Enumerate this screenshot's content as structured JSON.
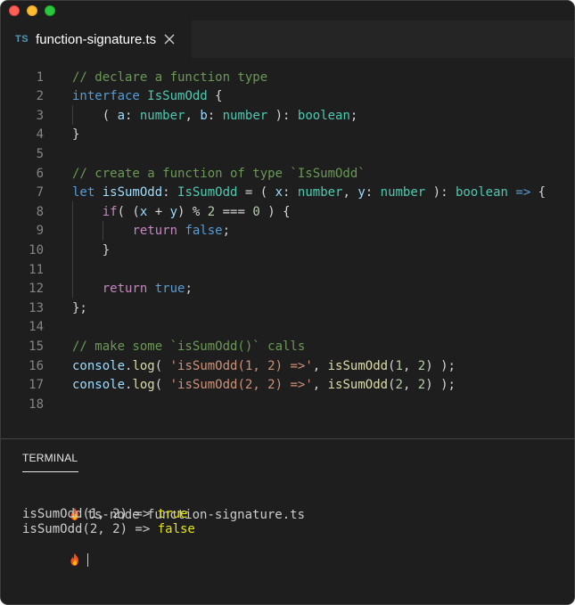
{
  "window": {
    "tab": {
      "lang_icon": "TS",
      "filename": "function-signature.ts",
      "close_icon": "close-icon"
    }
  },
  "editor": {
    "lines": [
      {
        "n": "1",
        "tokens": [
          {
            "t": "// declare a function type",
            "c": "c"
          }
        ]
      },
      {
        "n": "2",
        "tokens": [
          {
            "t": "interface ",
            "c": "k"
          },
          {
            "t": "IsSumOdd",
            "c": "t"
          },
          {
            "t": " {",
            "c": "p"
          }
        ]
      },
      {
        "n": "3",
        "tokens": [
          {
            "t": "    ( ",
            "c": "p"
          },
          {
            "t": "a",
            "c": "v"
          },
          {
            "t": ": ",
            "c": "p"
          },
          {
            "t": "number",
            "c": "t"
          },
          {
            "t": ", ",
            "c": "p"
          },
          {
            "t": "b",
            "c": "v"
          },
          {
            "t": ": ",
            "c": "p"
          },
          {
            "t": "number",
            "c": "t"
          },
          {
            "t": " ): ",
            "c": "p"
          },
          {
            "t": "boolean",
            "c": "t"
          },
          {
            "t": ";",
            "c": "p"
          }
        ]
      },
      {
        "n": "4",
        "tokens": [
          {
            "t": "}",
            "c": "p"
          }
        ]
      },
      {
        "n": "5",
        "tokens": []
      },
      {
        "n": "6",
        "tokens": [
          {
            "t": "// create a function of type `IsSumOdd`",
            "c": "c"
          }
        ]
      },
      {
        "n": "7",
        "tokens": [
          {
            "t": "let ",
            "c": "k"
          },
          {
            "t": "isSumOdd",
            "c": "v"
          },
          {
            "t": ": ",
            "c": "p"
          },
          {
            "t": "IsSumOdd",
            "c": "t"
          },
          {
            "t": " = ( ",
            "c": "p"
          },
          {
            "t": "x",
            "c": "v"
          },
          {
            "t": ": ",
            "c": "p"
          },
          {
            "t": "number",
            "c": "t"
          },
          {
            "t": ", ",
            "c": "p"
          },
          {
            "t": "y",
            "c": "v"
          },
          {
            "t": ": ",
            "c": "p"
          },
          {
            "t": "number",
            "c": "t"
          },
          {
            "t": " ): ",
            "c": "p"
          },
          {
            "t": "boolean",
            "c": "t"
          },
          {
            "t": " ",
            "c": "p"
          },
          {
            "t": "=>",
            "c": "k"
          },
          {
            "t": " {",
            "c": "p"
          }
        ]
      },
      {
        "n": "8",
        "tokens": [
          {
            "t": "    ",
            "c": "p"
          },
          {
            "t": "if",
            "c": "ck"
          },
          {
            "t": "( (",
            "c": "p"
          },
          {
            "t": "x",
            "c": "v"
          },
          {
            "t": " + ",
            "c": "p"
          },
          {
            "t": "y",
            "c": "v"
          },
          {
            "t": ") % ",
            "c": "p"
          },
          {
            "t": "2",
            "c": "n"
          },
          {
            "t": " === ",
            "c": "p"
          },
          {
            "t": "0",
            "c": "n"
          },
          {
            "t": " ) {",
            "c": "p"
          }
        ]
      },
      {
        "n": "9",
        "tokens": [
          {
            "t": "        ",
            "c": "p"
          },
          {
            "t": "return ",
            "c": "ck"
          },
          {
            "t": "false",
            "c": "k"
          },
          {
            "t": ";",
            "c": "p"
          }
        ]
      },
      {
        "n": "10",
        "tokens": [
          {
            "t": "    }",
            "c": "p"
          }
        ]
      },
      {
        "n": "11",
        "tokens": []
      },
      {
        "n": "12",
        "tokens": [
          {
            "t": "    ",
            "c": "p"
          },
          {
            "t": "return ",
            "c": "ck"
          },
          {
            "t": "true",
            "c": "k"
          },
          {
            "t": ";",
            "c": "p"
          }
        ]
      },
      {
        "n": "13",
        "tokens": [
          {
            "t": "};",
            "c": "p"
          }
        ]
      },
      {
        "n": "14",
        "tokens": []
      },
      {
        "n": "15",
        "tokens": [
          {
            "t": "// make some `isSumOdd()` calls",
            "c": "c"
          }
        ]
      },
      {
        "n": "16",
        "tokens": [
          {
            "t": "console",
            "c": "v"
          },
          {
            "t": ".",
            "c": "p"
          },
          {
            "t": "log",
            "c": "f"
          },
          {
            "t": "( ",
            "c": "p"
          },
          {
            "t": "'isSumOdd(1, 2) =>'",
            "c": "s"
          },
          {
            "t": ", ",
            "c": "p"
          },
          {
            "t": "isSumOdd",
            "c": "f"
          },
          {
            "t": "(",
            "c": "p"
          },
          {
            "t": "1",
            "c": "n"
          },
          {
            "t": ", ",
            "c": "p"
          },
          {
            "t": "2",
            "c": "n"
          },
          {
            "t": ") );",
            "c": "p"
          }
        ]
      },
      {
        "n": "17",
        "tokens": [
          {
            "t": "console",
            "c": "v"
          },
          {
            "t": ".",
            "c": "p"
          },
          {
            "t": "log",
            "c": "f"
          },
          {
            "t": "( ",
            "c": "p"
          },
          {
            "t": "'isSumOdd(2, 2) =>'",
            "c": "s"
          },
          {
            "t": ", ",
            "c": "p"
          },
          {
            "t": "isSumOdd",
            "c": "f"
          },
          {
            "t": "(",
            "c": "p"
          },
          {
            "t": "2",
            "c": "n"
          },
          {
            "t": ", ",
            "c": "p"
          },
          {
            "t": "2",
            "c": "n"
          },
          {
            "t": ") );",
            "c": "p"
          }
        ]
      },
      {
        "n": "18",
        "tokens": []
      }
    ]
  },
  "terminal": {
    "tab_label": "TERMINAL",
    "prompt_icon": "fire-icon",
    "command": "ts-node function-signature.ts",
    "output": [
      {
        "prefix": "isSumOdd(1, 2) => ",
        "value": "true"
      },
      {
        "prefix": "isSumOdd(2, 2) => ",
        "value": "false"
      }
    ]
  },
  "colors": {
    "keyword": "#569cd6",
    "comment": "#6a9955",
    "type": "#4ec9b0",
    "variable": "#9cdcfe",
    "function": "#dcdcaa",
    "string": "#ce9178",
    "number": "#b5cea8",
    "control": "#c586c0",
    "terminal_value": "#e5e510"
  }
}
